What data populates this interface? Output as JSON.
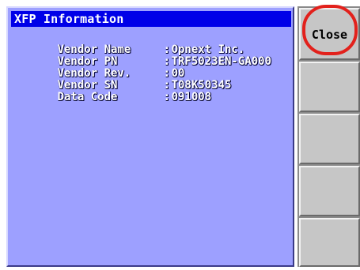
{
  "window": {
    "title": "XFP Information"
  },
  "info": {
    "rows": [
      {
        "label": "Vendor Name",
        "value": "Opnext Inc."
      },
      {
        "label": "Vendor PN",
        "value": "TRF5023EN-GA000"
      },
      {
        "label": "Vendor Rev.",
        "value": "00"
      },
      {
        "label": "Vendor SN",
        "value": "T08K50345"
      },
      {
        "label": "Data Code",
        "value": "091008"
      }
    ]
  },
  "buttons": {
    "close_label": "Close"
  },
  "colors": {
    "title_bar": "#0000e8",
    "panel_background": "#9da0ff",
    "button_face": "#c6c6c6",
    "highlight_circle": "#e2211c"
  }
}
